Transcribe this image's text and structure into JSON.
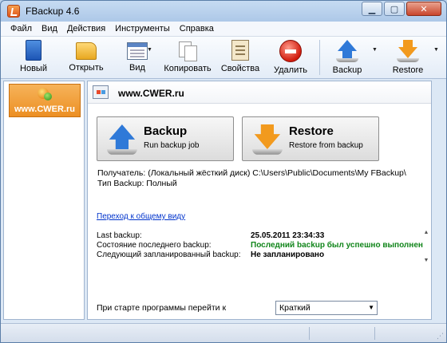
{
  "window": {
    "title": "FBackup  4.6"
  },
  "menu": [
    "Файл",
    "Вид",
    "Действия",
    "Инструменты",
    "Справка"
  ],
  "toolbar": {
    "new": "Новый",
    "open": "Открыть",
    "view": "Вид",
    "copy": "Копировать",
    "properties": "Свойства",
    "delete": "Удалить",
    "backup": "Backup",
    "restore": "Restore"
  },
  "sidebar": {
    "job": "www.CWER.ru"
  },
  "job": {
    "title": "www.CWER.ru",
    "backup_title": "Backup",
    "backup_sub": "Run backup job",
    "restore_title": "Restore",
    "restore_sub": "Restore from backup",
    "destination": "Получатель: (Локальный жёсткий диск) C:\\Users\\Public\\Documents\\My FBackup\\",
    "type": "Тип Backup: Полный",
    "overview_link": "Переход к общему виду",
    "status": [
      {
        "label": "Last backup:",
        "value": "25.05.2011 23:34:33",
        "color": "#000000"
      },
      {
        "label": "Состояние последнего backup:",
        "value": "Последний backup был успешно выполнен",
        "color": "#10851a"
      },
      {
        "label": "Следующий запланированный backup:",
        "value": "Не запланировано",
        "color": "#000000"
      }
    ],
    "startup_label": "При старте программы перейти к",
    "startup_value": "Краткий"
  }
}
